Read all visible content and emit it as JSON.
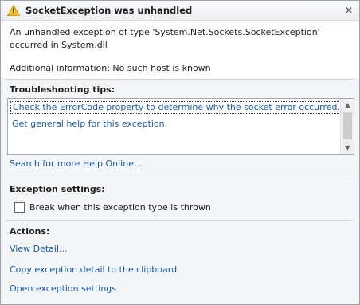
{
  "dialog": {
    "title": "SocketException was unhandled",
    "close_glyph": "✕",
    "message": "An unhandled exception of type 'System.Net.Sockets.SocketException' occurred in System.dll",
    "additional_info": "Additional information: No such host is known"
  },
  "troubleshooting": {
    "label": "Troubleshooting tips:",
    "tips": [
      "Check the ErrorCode property to determine why the socket error occurred.",
      "Get general help for this exception."
    ],
    "search_link": "Search for more Help Online..."
  },
  "exception_settings": {
    "label": "Exception settings:",
    "checkbox_label": "Break when this exception type is thrown",
    "checked": false
  },
  "actions": {
    "label": "Actions:",
    "items": [
      "View Detail...",
      "Copy exception detail to the clipboard",
      "Open exception settings"
    ]
  },
  "colors": {
    "link": "#1a5aa8",
    "warning_yellow": "#f5c21b"
  }
}
